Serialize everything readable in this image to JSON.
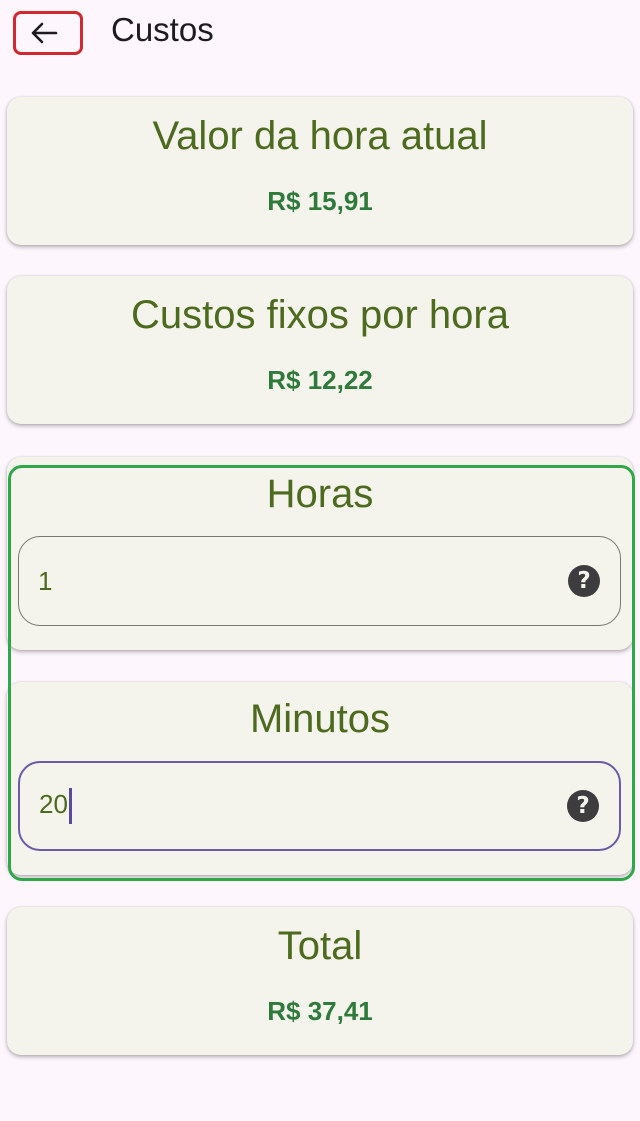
{
  "header": {
    "title": "Custos",
    "back_icon": "arrow-left-icon"
  },
  "cards": {
    "hora_atual": {
      "title": "Valor da hora atual",
      "value": "R$ 15,91"
    },
    "custos_fixos": {
      "title": "Custos fixos por hora",
      "value": "R$ 12,22"
    },
    "horas": {
      "title": "Horas",
      "input_value": "1",
      "help_icon": "help-circle-icon"
    },
    "minutos": {
      "title": "Minutos",
      "input_value": "20",
      "help_icon": "help-circle-icon"
    },
    "total": {
      "title": "Total",
      "value": "R$ 37,41"
    }
  },
  "colors": {
    "background": "#fdf6fd",
    "card": "#f4f3ec",
    "title_green": "#4d6b1e",
    "value_green": "#2e7a3a",
    "focus_border": "#6b5ba8",
    "highlight_green": "#2fa84a",
    "highlight_red": "#d0282e"
  }
}
